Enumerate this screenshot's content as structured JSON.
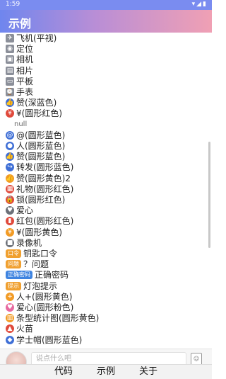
{
  "status": {
    "time": "1:59",
    "icons": [
      "wifi-icon",
      "signal-icon",
      "battery-icon"
    ]
  },
  "appbar": {
    "title": "示例"
  },
  "list": {
    "items": [
      {
        "label": "飞机(平视)",
        "icon": "plane-icon",
        "style": "gray"
      },
      {
        "label": "定位",
        "icon": "location-icon",
        "style": "gray"
      },
      {
        "label": "相机",
        "icon": "camera-icon",
        "style": "gray"
      },
      {
        "label": "相片",
        "icon": "photo-icon",
        "style": "gray"
      },
      {
        "label": "平板",
        "icon": "tablet-icon",
        "style": "gray"
      },
      {
        "label": "手表",
        "icon": "watch-icon",
        "style": "gray"
      },
      {
        "label": "赞(深蓝色)",
        "icon": "thumbs-up-icon",
        "style": "blue"
      },
      {
        "label": "¥(圆形红色)",
        "icon": "yen-icon",
        "style": "red"
      },
      {
        "label": "null",
        "icon": "",
        "style": "null"
      },
      {
        "label": "@(圆形蓝色)",
        "icon": "at-icon",
        "style": "blue"
      },
      {
        "label": "人(圆形蓝色)",
        "icon": "person-icon",
        "style": "blue"
      },
      {
        "label": "赞(圆形蓝色)",
        "icon": "thumbs-up-icon",
        "style": "blue"
      },
      {
        "label": "转发(圆形蓝色)",
        "icon": "share-icon",
        "style": "blue"
      },
      {
        "label": "赞(圆形黄色)2",
        "icon": "thumbs-up-icon",
        "style": "orange"
      },
      {
        "label": "礼物(圆形红色)",
        "icon": "gift-icon",
        "style": "red"
      },
      {
        "label": "锁(圆形红色)",
        "icon": "lock-icon",
        "style": "red"
      },
      {
        "label": "爱心",
        "icon": "heart-icon",
        "style": "darkgray"
      },
      {
        "label": "红包(圆形红色)",
        "icon": "red-envelope-icon",
        "style": "red"
      },
      {
        "label": "¥(圆形黄色)",
        "icon": "yen-icon",
        "style": "orange"
      },
      {
        "label": "录像机",
        "icon": "video-camera-icon",
        "style": "darkgray"
      },
      {
        "label": "钥匙口令",
        "icon": "key-icon",
        "style": "tag-orange",
        "tag": "口令"
      },
      {
        "label": "？问题",
        "icon": "question-icon",
        "style": "tag-orange",
        "tag": "问题"
      },
      {
        "label": "正确密码",
        "icon": "password-icon",
        "style": "tag-blue",
        "tag": "正确密码"
      },
      {
        "label": "灯泡提示",
        "icon": "lightbulb-icon",
        "style": "tag-orange",
        "tag": "提示"
      },
      {
        "label": "人+(圆形黄色)",
        "icon": "add-person-icon",
        "style": "orange"
      },
      {
        "label": "爱心(圆形粉色)",
        "icon": "heart-icon",
        "style": "pink"
      },
      {
        "label": "条型统计图(圆形黄色)",
        "icon": "bar-chart-icon",
        "style": "orange"
      },
      {
        "label": "火苗",
        "icon": "flame-icon",
        "style": "red"
      },
      {
        "label": "学士帽(圆形蓝色)",
        "icon": "graduation-cap-icon",
        "style": "blue"
      }
    ]
  },
  "input": {
    "placeholder": "说点什么吧",
    "emoji": "表情"
  },
  "nav": {
    "code": "代码",
    "example": "示例",
    "about": "关于"
  },
  "colors": {
    "accent": "#7a8cf0"
  }
}
